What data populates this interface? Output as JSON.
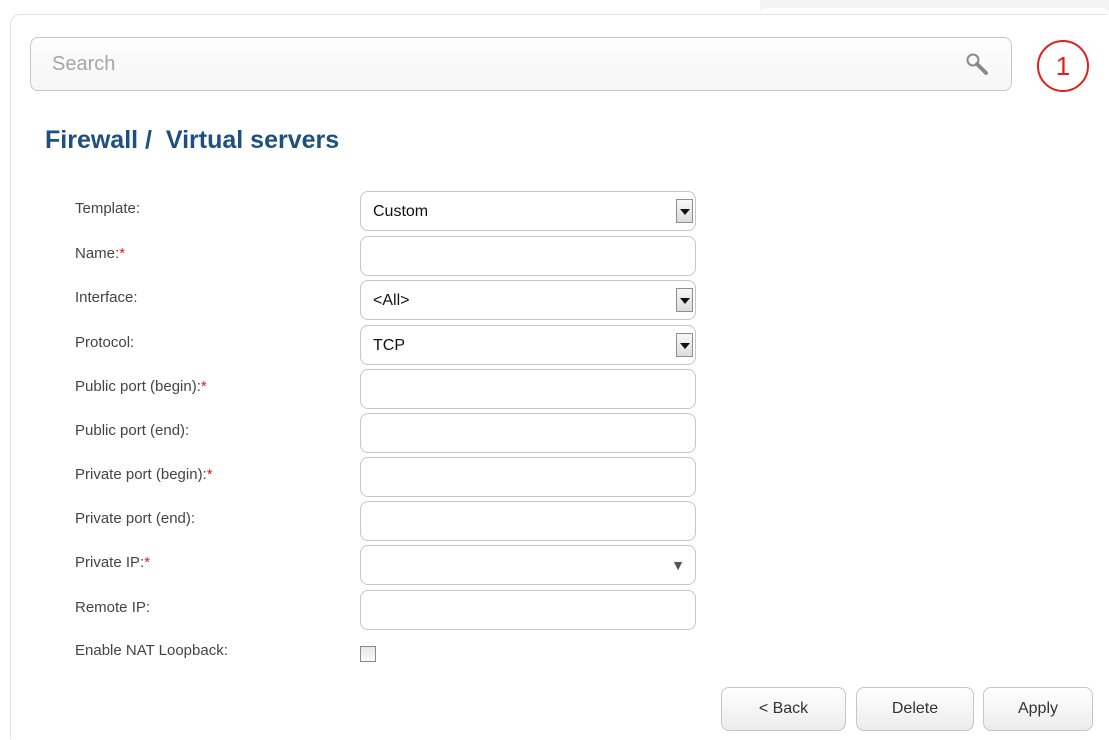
{
  "search": {
    "placeholder": "Search"
  },
  "notification": {
    "count": "1"
  },
  "page_title": "Firewall /  Virtual servers",
  "form": {
    "template": {
      "label": "Template:",
      "value": "Custom"
    },
    "name": {
      "label": "Name:",
      "required": "*",
      "value": ""
    },
    "interface": {
      "label": "Interface:",
      "value": "<All>"
    },
    "protocol": {
      "label": "Protocol:",
      "value": "TCP"
    },
    "public_port_begin": {
      "label": "Public port (begin):",
      "required": "*",
      "value": ""
    },
    "public_port_end": {
      "label": "Public port (end):",
      "value": ""
    },
    "private_port_begin": {
      "label": "Private port (begin):",
      "required": "*",
      "value": ""
    },
    "private_port_end": {
      "label": "Private port (end):",
      "value": ""
    },
    "private_ip": {
      "label": "Private IP:",
      "required": "*",
      "value": ""
    },
    "remote_ip": {
      "label": "Remote IP:",
      "value": ""
    },
    "nat_loopback": {
      "label": "Enable NAT Loopback:",
      "checked": false
    }
  },
  "buttons": {
    "back": "< Back",
    "delete": "Delete",
    "apply": "Apply"
  },
  "colors": {
    "title": "#1d4f80",
    "required": "#d42020",
    "notification": "#e0201b"
  }
}
